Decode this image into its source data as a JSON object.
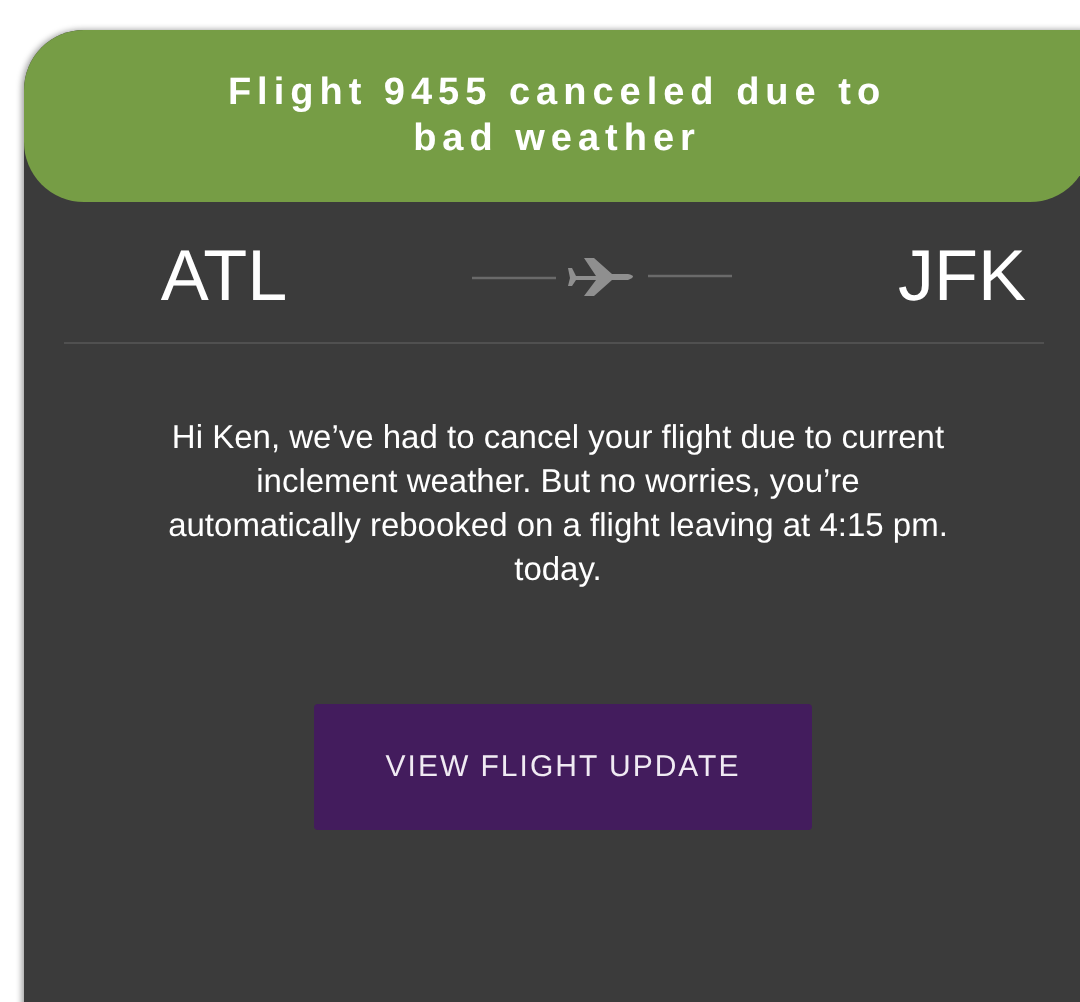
{
  "header": {
    "title": "Flight 9455 canceled due to bad weather"
  },
  "route": {
    "origin": "ATL",
    "destination": "JFK"
  },
  "message": "Hi Ken, we’ve had to cancel your flight due to current inclement weather. But no worries, you’re automatically rebooked on a flight leaving at 4:15 pm. today.",
  "button": {
    "label": "VIEW FLIGHT UPDATE"
  }
}
